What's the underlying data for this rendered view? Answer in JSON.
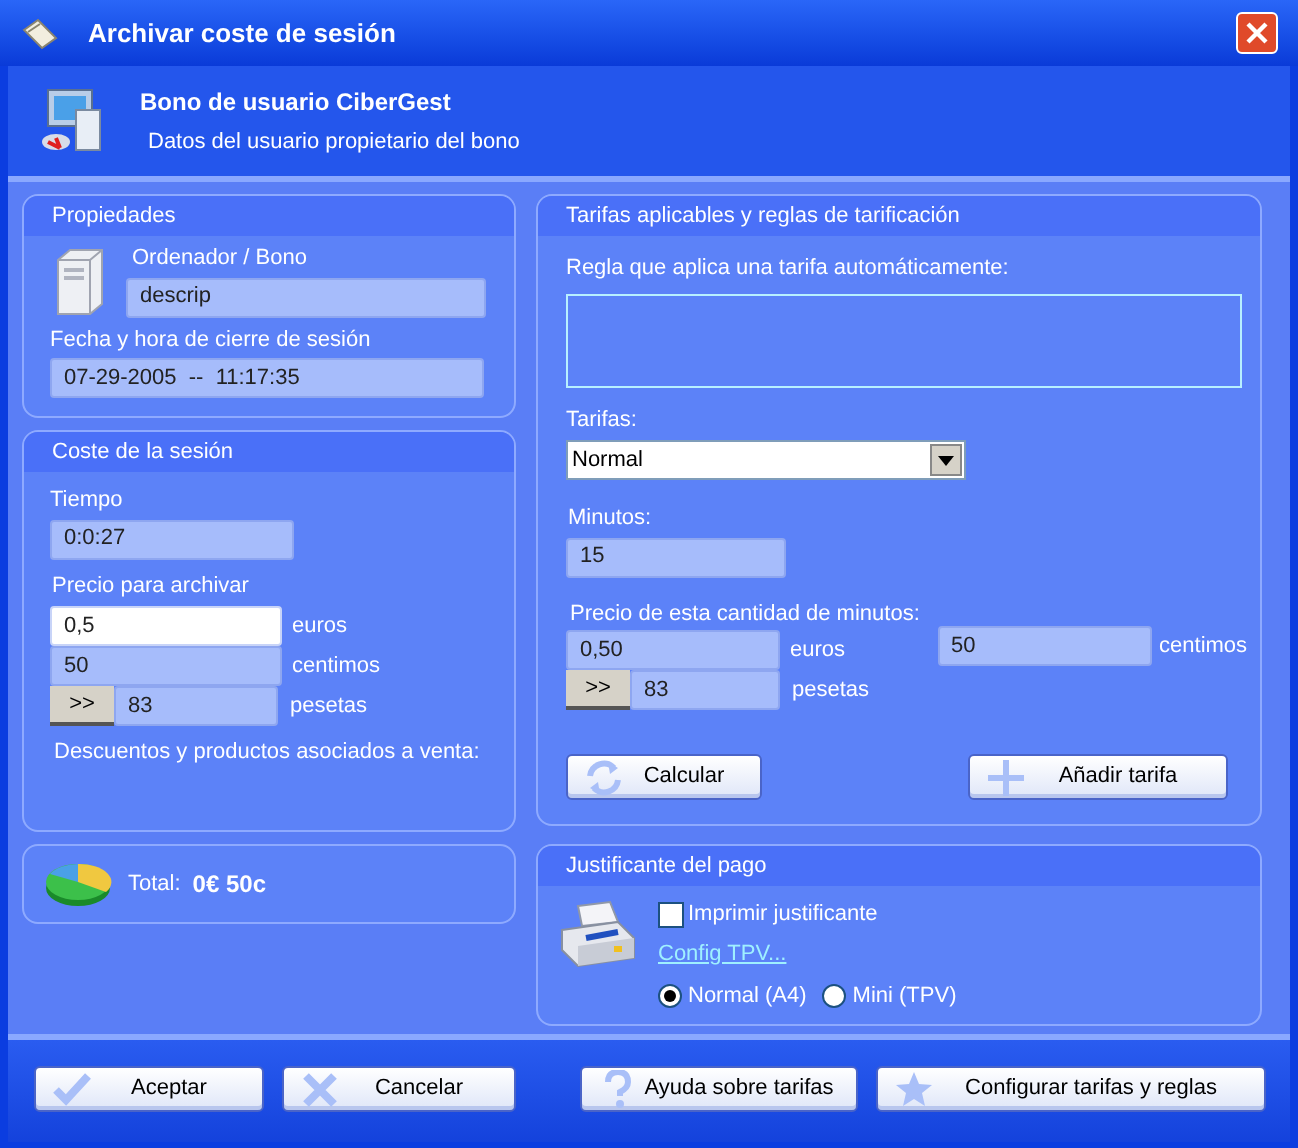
{
  "window": {
    "title": "Archivar coste de sesión"
  },
  "header": {
    "title": "Bono de usuario CiberGest",
    "subtitle": "Datos del usuario propietario del bono"
  },
  "properties": {
    "title": "Propiedades",
    "computer_label": "Ordenador / Bono",
    "computer_value": "descrip",
    "close_label": "Fecha y hora de cierre de sesión",
    "close_value": "07-29-2005  --  11:17:35"
  },
  "session_cost": {
    "title": "Coste de la sesión",
    "time_label": "Tiempo",
    "time_value": "0:0:27",
    "price_label": "Precio para archivar",
    "euros_value": "0,5",
    "euros_unit": "euros",
    "cents_value": "50",
    "cents_unit": "centimos",
    "convert_button": ">>",
    "pesetas_value": "83",
    "pesetas_unit": "pesetas",
    "discounts_label": "Descuentos y productos asociados a venta:"
  },
  "total": {
    "label": "Total:",
    "value": "0€ 50c"
  },
  "rates": {
    "title": "Tarifas aplicables y reglas de tarificación",
    "rule_label": "Regla que aplica una tarifa automáticamente:",
    "rates_label": "Tarifas:",
    "rate_value": "Normal",
    "minutes_label": "Minutos:",
    "minutes_value": "15",
    "price_label": "Precio de esta cantidad de minutos:",
    "euros_value": "0,50",
    "euros_unit": "euros",
    "cents_value": "50",
    "cents_unit": "centimos",
    "convert_button": ">>",
    "pesetas_value": "83",
    "pesetas_unit": "pesetas",
    "buttons": [
      {
        "label": "Calcular",
        "kind": "refresh"
      },
      {
        "label": "Añadir tarifa",
        "kind": "plus"
      }
    ]
  },
  "receipt": {
    "title": "Justificante del pago",
    "print_label": "Imprimir justificante",
    "print_checked": false,
    "config_link": "Config TPV...",
    "formats": [
      {
        "label": "Normal (A4)",
        "selected": true
      },
      {
        "label": "Mini (TPV)",
        "selected": false
      }
    ]
  },
  "buttons": [
    {
      "label": "Aceptar",
      "kind": "check"
    },
    {
      "label": "Cancelar",
      "kind": "cross"
    },
    {
      "label": "Ayuda sobre tarifas",
      "kind": "help"
    },
    {
      "label": "Configurar tarifas y reglas",
      "kind": "star"
    }
  ]
}
